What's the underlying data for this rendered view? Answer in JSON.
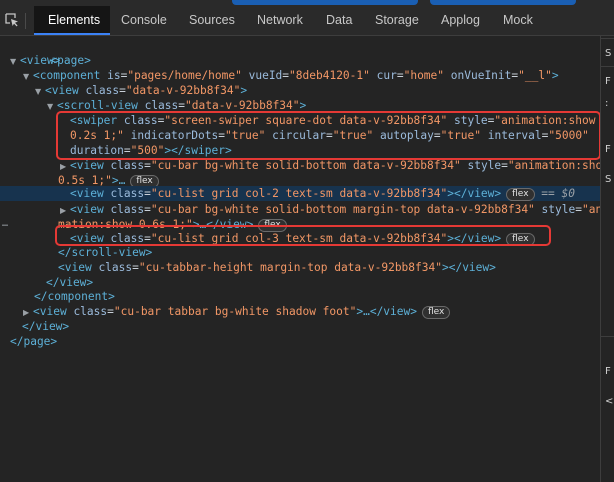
{
  "devtools": {
    "tabs": [
      {
        "label": "Elements",
        "active": true
      },
      {
        "label": "Console",
        "active": false
      },
      {
        "label": "Sources",
        "active": false
      },
      {
        "label": "Network",
        "active": false
      },
      {
        "label": "Data",
        "active": false
      },
      {
        "label": "Storage",
        "active": false
      },
      {
        "label": "Applog",
        "active": false
      },
      {
        "label": "Mock",
        "active": false
      }
    ],
    "icons": {
      "inspect": "inspect-element-icon",
      "expanded": "triangle-down-icon",
      "collapsed": "triangle-right-icon"
    },
    "colors": {
      "tag": "#5db0d7",
      "attribute": "#9bbbdc",
      "value": "#f29766",
      "selected_row": "#17334e",
      "highlight": "#e53935",
      "active_tab_underline": "#3b82f6"
    }
  },
  "tree": {
    "l1": {
      "tag": "<page>"
    },
    "l2": {
      "tag": "<view>"
    },
    "l3": {
      "open": "<component",
      "is_attr": "is",
      "is_val": "\"pages/home/home\"",
      "vueid_attr": "vueId",
      "vueid_val": "\"8deb4120-1\"",
      "cur_attr": "cur",
      "cur_val": "\"home\"",
      "init_attr": "onVueInit",
      "init_val": "\"__l\"",
      "close": ">"
    },
    "l4": {
      "open": "<view",
      "class_attr": "class",
      "class_val": "\"data-v-92bb8f34\"",
      "close": ">"
    },
    "l5": {
      "open": "<scroll-view",
      "class_attr": "class",
      "class_val": "\"data-v-92bb8f34\"",
      "close": ">"
    },
    "swiper": {
      "open": "<swiper",
      "class_attr": "class",
      "class_val": "\"screen-swiper square-dot data-v-92bb8f34\"",
      "style_attr": "style",
      "style_val_1": "\"animation:show",
      "style_val_2": "0.2s 1;\"",
      "dots_attr": "indicatorDots",
      "dots_val": "\"true\"",
      "circ_attr": "circular",
      "circ_val": "\"true\"",
      "auto_attr": "autoplay",
      "auto_val": "\"true\"",
      "int_attr": "interval",
      "int_val": "\"5000\"",
      "dur_attr": "duration",
      "dur_val": "\"500\"",
      "close": "></swiper>"
    },
    "bar1": {
      "open": "<view",
      "class_attr": "class",
      "class_val": "\"cu-bar bg-white solid-bottom data-v-92bb8f34\"",
      "style_attr": "style",
      "style_val_1": "\"animation:show",
      "style_val_2": "0.5s 1;\"",
      "close": ">…",
      "badge": "flex"
    },
    "grid2": {
      "open": "<view",
      "class_attr": "class",
      "class_val": "\"cu-list grid col-2 text-sm data-v-92bb8f34\"",
      "close": "></view>",
      "badge": "flex",
      "selected_note": "== $0",
      "gutter": "…"
    },
    "bar2": {
      "open": "<view",
      "class_attr": "class",
      "class_val": "\"cu-bar bg-white solid-bottom margin-top data-v-92bb8f34\"",
      "style_attr": "style",
      "style_val_1": "\"ani",
      "style_val_2": "mation:show 0.6s 1;\"",
      "close": ">…</view>",
      "badge": "flex"
    },
    "grid3": {
      "open": "<view",
      "class_attr": "class",
      "class_val": "\"cu-list grid col-3 text-sm data-v-92bb8f34\"",
      "close": "></view>",
      "badge": "flex"
    },
    "close_scroll": "</scroll-view>",
    "tabbar_height": {
      "open": "<view",
      "class_attr": "class",
      "class_val": "\"cu-tabbar-height margin-top data-v-92bb8f34\"",
      "close": "></view>"
    },
    "close_view1": "</view>",
    "close_component": "</component>",
    "tabbar": {
      "open": "<view",
      "class_attr": "class",
      "class_val": "\"cu-bar tabbar bg-white shadow foot\"",
      "close": ">…</view>",
      "badge": "flex"
    },
    "close_view2": "</view>",
    "close_page": "</page>"
  },
  "side_panel": {
    "glyphs": [
      "S",
      "F",
      ":",
      "F",
      "S",
      "F",
      "<"
    ]
  }
}
